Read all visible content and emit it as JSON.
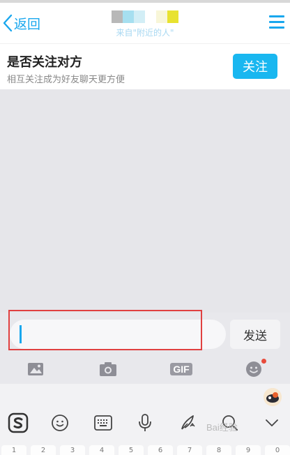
{
  "header": {
    "back_label": "返回",
    "subtitle": "来自\"附近的人\"",
    "title_pixel_colors": [
      "#b8b8b8",
      "#a6dff0",
      "#d2eef6",
      "#ffffff",
      "#f8f6d8",
      "#e8e230"
    ]
  },
  "follow": {
    "title": "是否关注对方",
    "description": "相互关注成为好友聊天更方便",
    "button_label": "关注"
  },
  "composer": {
    "input_value": "",
    "send_label": "发送"
  },
  "toolbar": {
    "gif_label": "GIF",
    "items": [
      "image-icon",
      "camera-icon",
      "gif-icon",
      "emoji-icon"
    ]
  },
  "ime": {
    "toolbar_items": [
      "sogou-logo-icon",
      "emoji-icon",
      "keyboard-icon",
      "microphone-icon",
      "handwriting-icon",
      "search-icon",
      "chevron-down-icon"
    ],
    "watermark": "Bai经验",
    "number_keys": [
      "1",
      "2",
      "3",
      "4",
      "5",
      "6",
      "7",
      "8",
      "9",
      "0"
    ]
  },
  "colors": {
    "accent": "#19a7ee",
    "follow_button": "#19b7f0",
    "highlight": "#e04040"
  }
}
